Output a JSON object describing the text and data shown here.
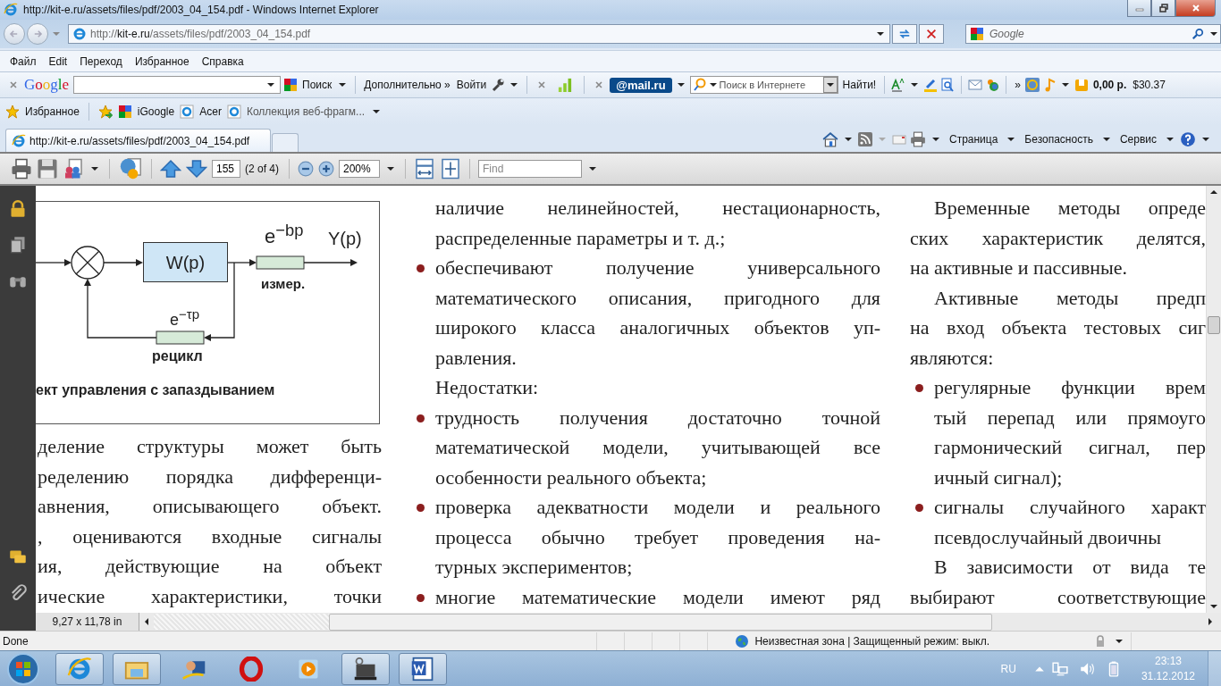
{
  "window": {
    "title": "http://kit-e.ru/assets/files/pdf/2003_04_154.pdf - Windows Internet Explorer"
  },
  "address_bar": {
    "url": "http://**kit-e.ru**/assets/files/pdf/2003_04_154.pdf"
  },
  "search_box": {
    "placeholder": "Google"
  },
  "menu": [
    "Файл",
    "Edit",
    "Переход",
    "Избранное",
    "Справка"
  ],
  "google_toolbar": {
    "logo": "Google",
    "search_button": "Поиск",
    "more": "Дополнительно »",
    "login": "Войти"
  },
  "mail_toolbar": {
    "logo": "@mail.ru",
    "search_placeholder": "Поиск в Интернете",
    "find_button": "Найти!",
    "more": "»",
    "balance": "0,00 р.",
    "rate": "$30.37"
  },
  "favorites": {
    "label": "Избранное",
    "links": [
      "iGoogle",
      "Acer",
      "Коллекция веб-фрагм..."
    ]
  },
  "tabs": [
    {
      "title": "http://kit-e.ru/assets/files/pdf/2003_04_154.pdf",
      "selected": true
    }
  ],
  "command_bar": [
    "Страница",
    "Безопасность",
    "Сервис"
  ],
  "pdf_toolbar": {
    "page": "155",
    "page_count": "(2 of 4)",
    "zoom": "200%",
    "find_placeholder": "Find"
  },
  "figure": {
    "block": "W(p)",
    "delay_out": "e$^{−bp}$",
    "output": "Y(p)",
    "measure": "измер.",
    "delay_back": "e$^{−τp}$",
    "recycle": "рецикл",
    "caption": "ект управления с запаздыванием"
  },
  "columns": [
    {
      "paragraphs": [
        {
          "kind": "text",
          "indent": false,
          "continues": true,
          "lines": [
            "деление структуры может быть",
            "ределению порядка дифференци-",
            "авнения, описывающего объект.",
            ", оцениваются входные сигналы",
            "ия,    действующие    на объект",
            "ические характеристики, точки"
          ]
        }
      ]
    },
    {
      "paragraphs": [
        {
          "kind": "continued",
          "indent": false,
          "lines": [
            "наличие нелинейностей, нестационарность,",
            "распределенные параметры и т. д.;"
          ]
        },
        {
          "kind": "bullet",
          "indent": false,
          "lines": [
            "обеспечивают получение универсального",
            "математического описания, пригодного для",
            "широкого класса аналогичных объектов уп-",
            "равления."
          ]
        },
        {
          "kind": "text",
          "indent": true,
          "lines": [
            "Недостатки:"
          ]
        },
        {
          "kind": "bullet",
          "indent": false,
          "lines": [
            "трудность получения достаточно точной",
            "математической модели, учитывающей все",
            "особенности реального объекта;"
          ]
        },
        {
          "kind": "bullet",
          "indent": false,
          "lines": [
            "проверка адекватности модели и реального",
            "процесса обычно требует проведения на-",
            "турных экспериментов;"
          ]
        },
        {
          "kind": "bullet",
          "indent": false,
          "continues": true,
          "lines": [
            "многие математические модели имеют ряд"
          ]
        }
      ]
    },
    {
      "paragraphs": [
        {
          "kind": "text",
          "indent": true,
          "lines": [
            "Временные методы опреде",
            "ских характеристик делятся,",
            "на активные и пассивные."
          ]
        },
        {
          "kind": "text",
          "indent": true,
          "lines": [
            "Активные методы предп",
            "на вход объекта тестовых сиг",
            "являются:"
          ]
        },
        {
          "kind": "bullet",
          "indent": false,
          "lines": [
            "регулярные функции врем",
            "тый перепад или прямоуго",
            "гармонический сигнал, пер",
            "ичный сигнал);"
          ]
        },
        {
          "kind": "bullet",
          "indent": false,
          "lines": [
            "сигналы случайного характ",
            "псевдослучайный двоичны"
          ]
        },
        {
          "kind": "text",
          "indent": true,
          "continues": true,
          "lines": [
            "В зависимости от вида те",
            "выбирают соответствующие"
          ]
        }
      ]
    }
  ],
  "page_size": "9,27 x 11,78 in",
  "status_bar": {
    "text": "Done",
    "zone": "Неизвестная зона | Защищенный режим: выкл."
  },
  "taskbar": {
    "language": "RU",
    "time": "23:13",
    "date": "31.12.2012"
  }
}
